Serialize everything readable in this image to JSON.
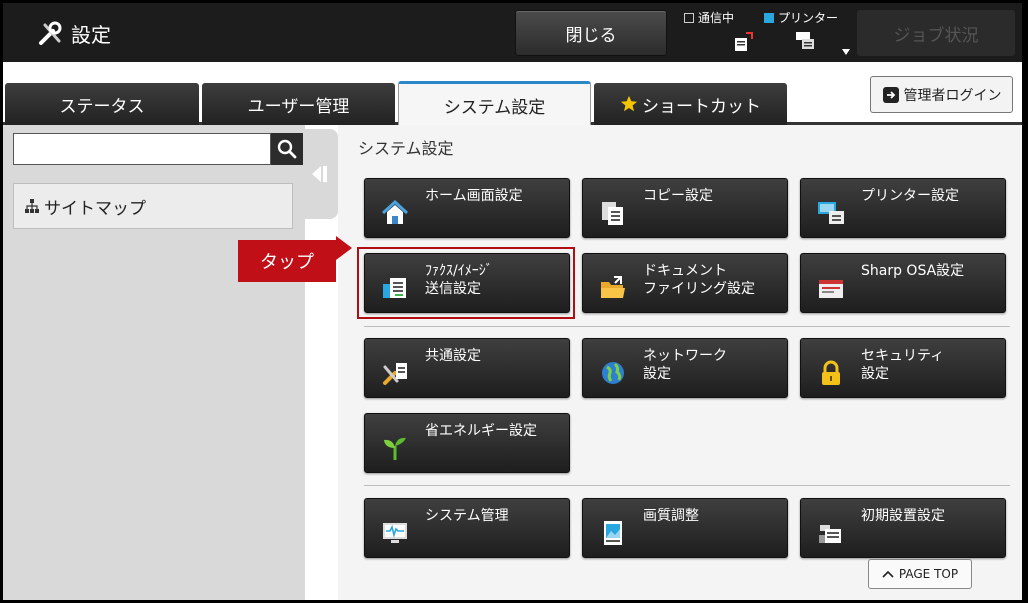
{
  "header": {
    "title": "設定",
    "close_label": "閉じる",
    "status_comm": "通信中",
    "status_printer": "プリンター",
    "job_status": "ジョブ状況",
    "printer_indicator_color": "#29a8df"
  },
  "tabs": [
    {
      "label": "ステータス"
    },
    {
      "label": "ユーザー管理"
    },
    {
      "label": "システム設定"
    },
    {
      "label": "ショートカット"
    }
  ],
  "admin_login": "管理者ログイン",
  "sidebar": {
    "search_placeholder": "",
    "sitemap_label": "サイトマップ"
  },
  "main": {
    "section_title": "システム設定",
    "tiles": [
      {
        "label": "ホーム画面設定",
        "icon": "home-icon"
      },
      {
        "label": "コピー設定",
        "icon": "copy-icon"
      },
      {
        "label": "プリンター設定",
        "icon": "printer-icon"
      },
      {
        "label": "ﾌｧｸｽ/ｲﾒｰｼﾞ\n送信設定",
        "icon": "fax-icon"
      },
      {
        "label": "ドキュメント\nファイリング設定",
        "icon": "folder-icon"
      },
      {
        "label": "Sharp OSA設定",
        "icon": "osa-icon"
      },
      {
        "label": "共通設定",
        "icon": "tools-icon"
      },
      {
        "label": "ネットワーク\n設定",
        "icon": "globe-icon"
      },
      {
        "label": "セキュリティ\n設定",
        "icon": "lock-icon"
      },
      {
        "label": "省エネルギー設定",
        "icon": "sprout-icon"
      },
      {
        "label": "システム管理",
        "icon": "monitor-icon"
      },
      {
        "label": "画質調整",
        "icon": "image-quality-icon"
      },
      {
        "label": "初期設置設定",
        "icon": "machine-icon"
      }
    ],
    "page_top": "PAGE TOP"
  },
  "callout": {
    "label": "タップ",
    "color": "#c00f17"
  }
}
